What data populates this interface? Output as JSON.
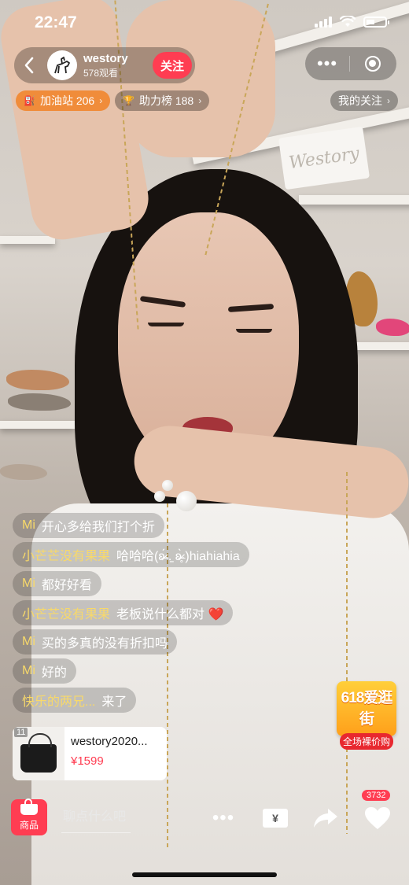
{
  "status_bar": {
    "time": "22:47"
  },
  "host": {
    "name": "westory",
    "views": "578观看",
    "follow_label": "关注",
    "avatar_text": "westory"
  },
  "chips": {
    "fuel_station": "加油站 206",
    "support_rank": "助力榜 188",
    "my_follow": "我的关注"
  },
  "scene": {
    "wall_logo": "Westory"
  },
  "comments": [
    {
      "user": "Mi",
      "text": "开心多给我们打个折"
    },
    {
      "user": "小芒芒没有果果",
      "text": "哈哈哈(ʚ̴̶̷́ .̠ ʚ̴̶̷̥̀ )hiahiahia"
    },
    {
      "user": "Mi",
      "text": "都好好看"
    },
    {
      "user": "小芒芒没有果果",
      "text": "老板说什么都对 ❤️"
    },
    {
      "user": "Mi",
      "text": "买的多真的没有折扣吗"
    },
    {
      "user": "Mi",
      "text": "好的"
    },
    {
      "user": "快乐的两兄...",
      "text": "来了"
    }
  ],
  "product": {
    "index": "11",
    "name": "westory2020...",
    "price": "¥1599"
  },
  "promo": {
    "title": "618爱逛街",
    "subtitle": "全场裸价购"
  },
  "bottom_bar": {
    "goods_label": "商品",
    "chat_placeholder": "聊点什么吧",
    "coupon_symbol": "¥",
    "like_count": "3732"
  },
  "colors": {
    "accent_red": "#ff3d52",
    "orange": "#f08c3a",
    "username_yellow": "#f8d96a"
  }
}
